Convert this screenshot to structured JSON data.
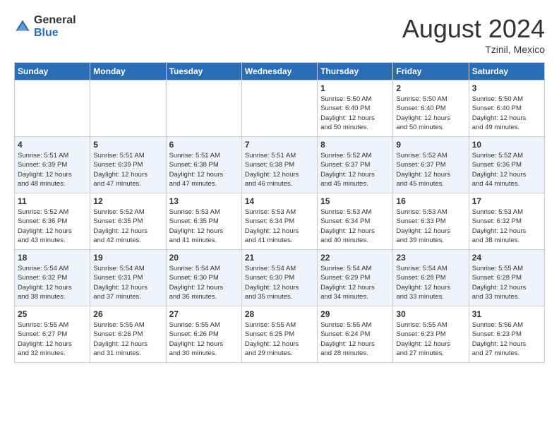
{
  "logo": {
    "general": "General",
    "blue": "Blue"
  },
  "title": "August 2024",
  "location": "Tzinil, Mexico",
  "days_of_week": [
    "Sunday",
    "Monday",
    "Tuesday",
    "Wednesday",
    "Thursday",
    "Friday",
    "Saturday"
  ],
  "weeks": [
    [
      {
        "day": "",
        "info": ""
      },
      {
        "day": "",
        "info": ""
      },
      {
        "day": "",
        "info": ""
      },
      {
        "day": "",
        "info": ""
      },
      {
        "day": "1",
        "info": "Sunrise: 5:50 AM\nSunset: 6:40 PM\nDaylight: 12 hours\nand 50 minutes."
      },
      {
        "day": "2",
        "info": "Sunrise: 5:50 AM\nSunset: 6:40 PM\nDaylight: 12 hours\nand 50 minutes."
      },
      {
        "day": "3",
        "info": "Sunrise: 5:50 AM\nSunset: 6:40 PM\nDaylight: 12 hours\nand 49 minutes."
      }
    ],
    [
      {
        "day": "4",
        "info": "Sunrise: 5:51 AM\nSunset: 6:39 PM\nDaylight: 12 hours\nand 48 minutes."
      },
      {
        "day": "5",
        "info": "Sunrise: 5:51 AM\nSunset: 6:39 PM\nDaylight: 12 hours\nand 47 minutes."
      },
      {
        "day": "6",
        "info": "Sunrise: 5:51 AM\nSunset: 6:38 PM\nDaylight: 12 hours\nand 47 minutes."
      },
      {
        "day": "7",
        "info": "Sunrise: 5:51 AM\nSunset: 6:38 PM\nDaylight: 12 hours\nand 46 minutes."
      },
      {
        "day": "8",
        "info": "Sunrise: 5:52 AM\nSunset: 6:37 PM\nDaylight: 12 hours\nand 45 minutes."
      },
      {
        "day": "9",
        "info": "Sunrise: 5:52 AM\nSunset: 6:37 PM\nDaylight: 12 hours\nand 45 minutes."
      },
      {
        "day": "10",
        "info": "Sunrise: 5:52 AM\nSunset: 6:36 PM\nDaylight: 12 hours\nand 44 minutes."
      }
    ],
    [
      {
        "day": "11",
        "info": "Sunrise: 5:52 AM\nSunset: 6:36 PM\nDaylight: 12 hours\nand 43 minutes."
      },
      {
        "day": "12",
        "info": "Sunrise: 5:52 AM\nSunset: 6:35 PM\nDaylight: 12 hours\nand 42 minutes."
      },
      {
        "day": "13",
        "info": "Sunrise: 5:53 AM\nSunset: 6:35 PM\nDaylight: 12 hours\nand 41 minutes."
      },
      {
        "day": "14",
        "info": "Sunrise: 5:53 AM\nSunset: 6:34 PM\nDaylight: 12 hours\nand 41 minutes."
      },
      {
        "day": "15",
        "info": "Sunrise: 5:53 AM\nSunset: 6:34 PM\nDaylight: 12 hours\nand 40 minutes."
      },
      {
        "day": "16",
        "info": "Sunrise: 5:53 AM\nSunset: 6:33 PM\nDaylight: 12 hours\nand 39 minutes."
      },
      {
        "day": "17",
        "info": "Sunrise: 5:53 AM\nSunset: 6:32 PM\nDaylight: 12 hours\nand 38 minutes."
      }
    ],
    [
      {
        "day": "18",
        "info": "Sunrise: 5:54 AM\nSunset: 6:32 PM\nDaylight: 12 hours\nand 38 minutes."
      },
      {
        "day": "19",
        "info": "Sunrise: 5:54 AM\nSunset: 6:31 PM\nDaylight: 12 hours\nand 37 minutes."
      },
      {
        "day": "20",
        "info": "Sunrise: 5:54 AM\nSunset: 6:30 PM\nDaylight: 12 hours\nand 36 minutes."
      },
      {
        "day": "21",
        "info": "Sunrise: 5:54 AM\nSunset: 6:30 PM\nDaylight: 12 hours\nand 35 minutes."
      },
      {
        "day": "22",
        "info": "Sunrise: 5:54 AM\nSunset: 6:29 PM\nDaylight: 12 hours\nand 34 minutes."
      },
      {
        "day": "23",
        "info": "Sunrise: 5:54 AM\nSunset: 6:28 PM\nDaylight: 12 hours\nand 33 minutes."
      },
      {
        "day": "24",
        "info": "Sunrise: 5:55 AM\nSunset: 6:28 PM\nDaylight: 12 hours\nand 33 minutes."
      }
    ],
    [
      {
        "day": "25",
        "info": "Sunrise: 5:55 AM\nSunset: 6:27 PM\nDaylight: 12 hours\nand 32 minutes."
      },
      {
        "day": "26",
        "info": "Sunrise: 5:55 AM\nSunset: 6:26 PM\nDaylight: 12 hours\nand 31 minutes."
      },
      {
        "day": "27",
        "info": "Sunrise: 5:55 AM\nSunset: 6:26 PM\nDaylight: 12 hours\nand 30 minutes."
      },
      {
        "day": "28",
        "info": "Sunrise: 5:55 AM\nSunset: 6:25 PM\nDaylight: 12 hours\nand 29 minutes."
      },
      {
        "day": "29",
        "info": "Sunrise: 5:55 AM\nSunset: 6:24 PM\nDaylight: 12 hours\nand 28 minutes."
      },
      {
        "day": "30",
        "info": "Sunrise: 5:55 AM\nSunset: 6:23 PM\nDaylight: 12 hours\nand 27 minutes."
      },
      {
        "day": "31",
        "info": "Sunrise: 5:56 AM\nSunset: 6:23 PM\nDaylight: 12 hours\nand 27 minutes."
      }
    ]
  ]
}
